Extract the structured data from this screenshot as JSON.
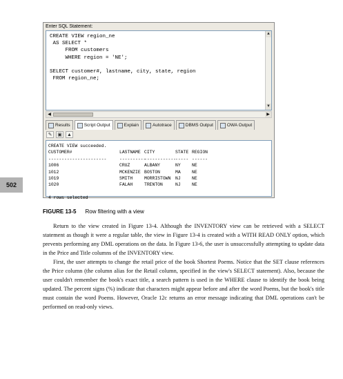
{
  "page_number": "502",
  "screenshot": {
    "label": "Enter SQL Statement:",
    "editor_lines": [
      "CREATE VIEW region_ne",
      " AS SELECT *",
      "     FROM customers",
      "     WHERE region = 'NE';",
      "",
      "SELECT customer#, lastname, city, state, region",
      " FROM region_ne;"
    ],
    "tabs": [
      "Results",
      "Script Output",
      "Explain",
      "Autotrace",
      "DBMS Output",
      "OWA Output"
    ],
    "output": {
      "status": "CREATE VIEW succeeded.",
      "headers": [
        "CUSTOMER#",
        "LASTNAME",
        "CITY",
        "STATE",
        "REGION"
      ],
      "dashes": [
        "----------------------",
        "----------",
        "------------",
        "-----",
        "------"
      ],
      "rows": [
        [
          "1006",
          "CRUZ",
          "ALBANY",
          "NY",
          "NE"
        ],
        [
          "1012",
          "MCKENZIE",
          "BOSTON",
          "MA",
          "NE"
        ],
        [
          "1019",
          "SMITH",
          "MORRISTOWN",
          "NJ",
          "NE"
        ],
        [
          "1020",
          "FALAH",
          "TRENTON",
          "NJ",
          "NE"
        ]
      ],
      "footer": "4 rows selected"
    }
  },
  "caption": {
    "label": "FIGURE 13-5",
    "text": "Row filtering with a view"
  },
  "paragraphs": [
    "Return to the view created in Figure 13-4. Although the INVENTORY view can be retrieved with a SELECT statement as though it were a regular table, the view in Figure 13-4 is created with a WITH READ ONLY option, which prevents performing any DML operations on the data. In Figure 13-6, the user is unsuccessfully attempting to update data in the Price and Title columns of the INVENTORY view.",
    "First, the user attempts to change the retail price of the book Shortest Poems. Notice that the SET clause references the Price column (the column alias for the Retail column, specified in the view's SELECT statement). Also, because the user couldn't remember the book's exact title, a search pattern is used in the WHERE clause to identify the book being updated. The percent signs (%) indicate that characters might appear before and after the word Poems, but the book's title must contain the word Poems. However, Oracle 12c returns an error message indicating that DML operations can't be performed on read-only views."
  ]
}
